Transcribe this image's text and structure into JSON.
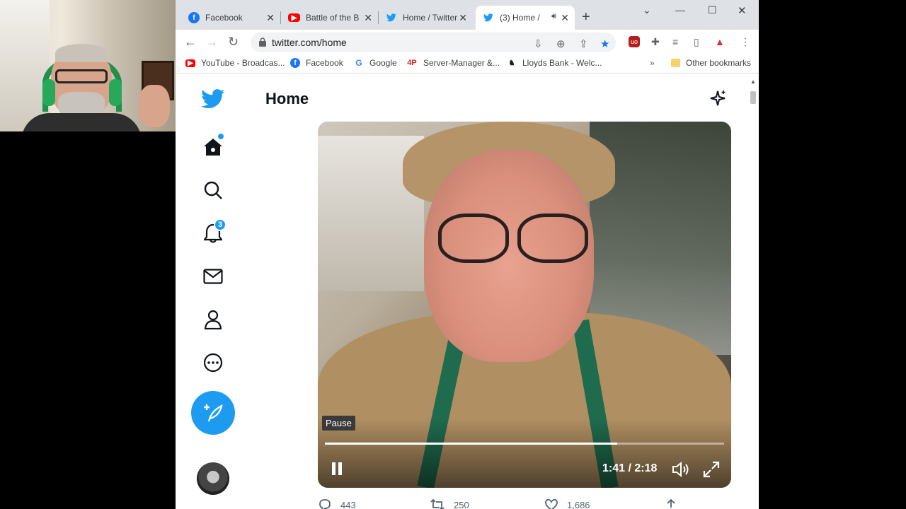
{
  "tabs": [
    {
      "title": "Facebook",
      "icon": "facebook-icon",
      "color": "#1877f2",
      "active": false
    },
    {
      "title": "Battle of the Bl",
      "icon": "youtube-icon",
      "color": "#ff0000",
      "active": false
    },
    {
      "title": "Home / Twitter",
      "icon": "twitter-icon",
      "color": "#1d9bf0",
      "active": false
    },
    {
      "title": "(3) Home /",
      "icon": "twitter-icon",
      "color": "#1d9bf0",
      "active": true,
      "audio": true
    }
  ],
  "address": {
    "url": "twitter.com/home"
  },
  "bookmarks": [
    {
      "label": "YouTube - Broadcas...",
      "icon": "youtube-icon"
    },
    {
      "label": "Facebook",
      "icon": "facebook-icon"
    },
    {
      "label": "Google",
      "icon": "google-icon"
    },
    {
      "label": "Server-Manager &...",
      "icon": "4p-icon",
      "icon_text": "4P"
    },
    {
      "label": "Lloyds Bank - Welc...",
      "icon": "lloyds-horse-icon"
    },
    {
      "label": "Other bookmarks",
      "icon": "folder-icon"
    }
  ],
  "twitter": {
    "header_title": "Home",
    "notifications_count": "3",
    "brand_color": "#1d9bf0"
  },
  "video": {
    "tooltip": "Pause",
    "time": "1:41 / 2:18",
    "progress": 0.732
  },
  "tweet_actions": {
    "replies": "443",
    "retweets": "250",
    "likes": "1,686"
  }
}
